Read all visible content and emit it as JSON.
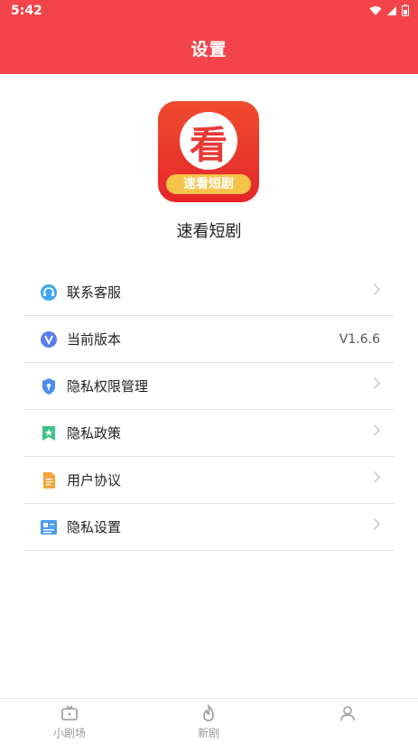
{
  "status": {
    "time": "5:42"
  },
  "header": {
    "title": "设置"
  },
  "app": {
    "logo_char": "看",
    "logo_text": "速看短剧",
    "name": "速看短剧"
  },
  "menu": [
    {
      "label": "联系客服",
      "icon": "headset-icon"
    },
    {
      "label": "当前版本",
      "value": "V1.6.6",
      "icon": "version-v-icon"
    },
    {
      "label": "隐私权限管理",
      "icon": "shield-icon"
    },
    {
      "label": "隐私政策",
      "icon": "bookmark-star-icon"
    },
    {
      "label": "用户协议",
      "icon": "document-icon"
    },
    {
      "label": "隐私设置",
      "icon": "id-card-icon"
    }
  ],
  "bottom_nav": [
    {
      "label": "小剧场",
      "icon": "tv-icon"
    },
    {
      "label": "新剧",
      "icon": "flame-icon"
    },
    {
      "label": "",
      "icon": "profile-icon"
    }
  ],
  "colors": {
    "header_bg": "#f2444a",
    "divider": "#e3e3e3",
    "nav_text": "#999999"
  }
}
